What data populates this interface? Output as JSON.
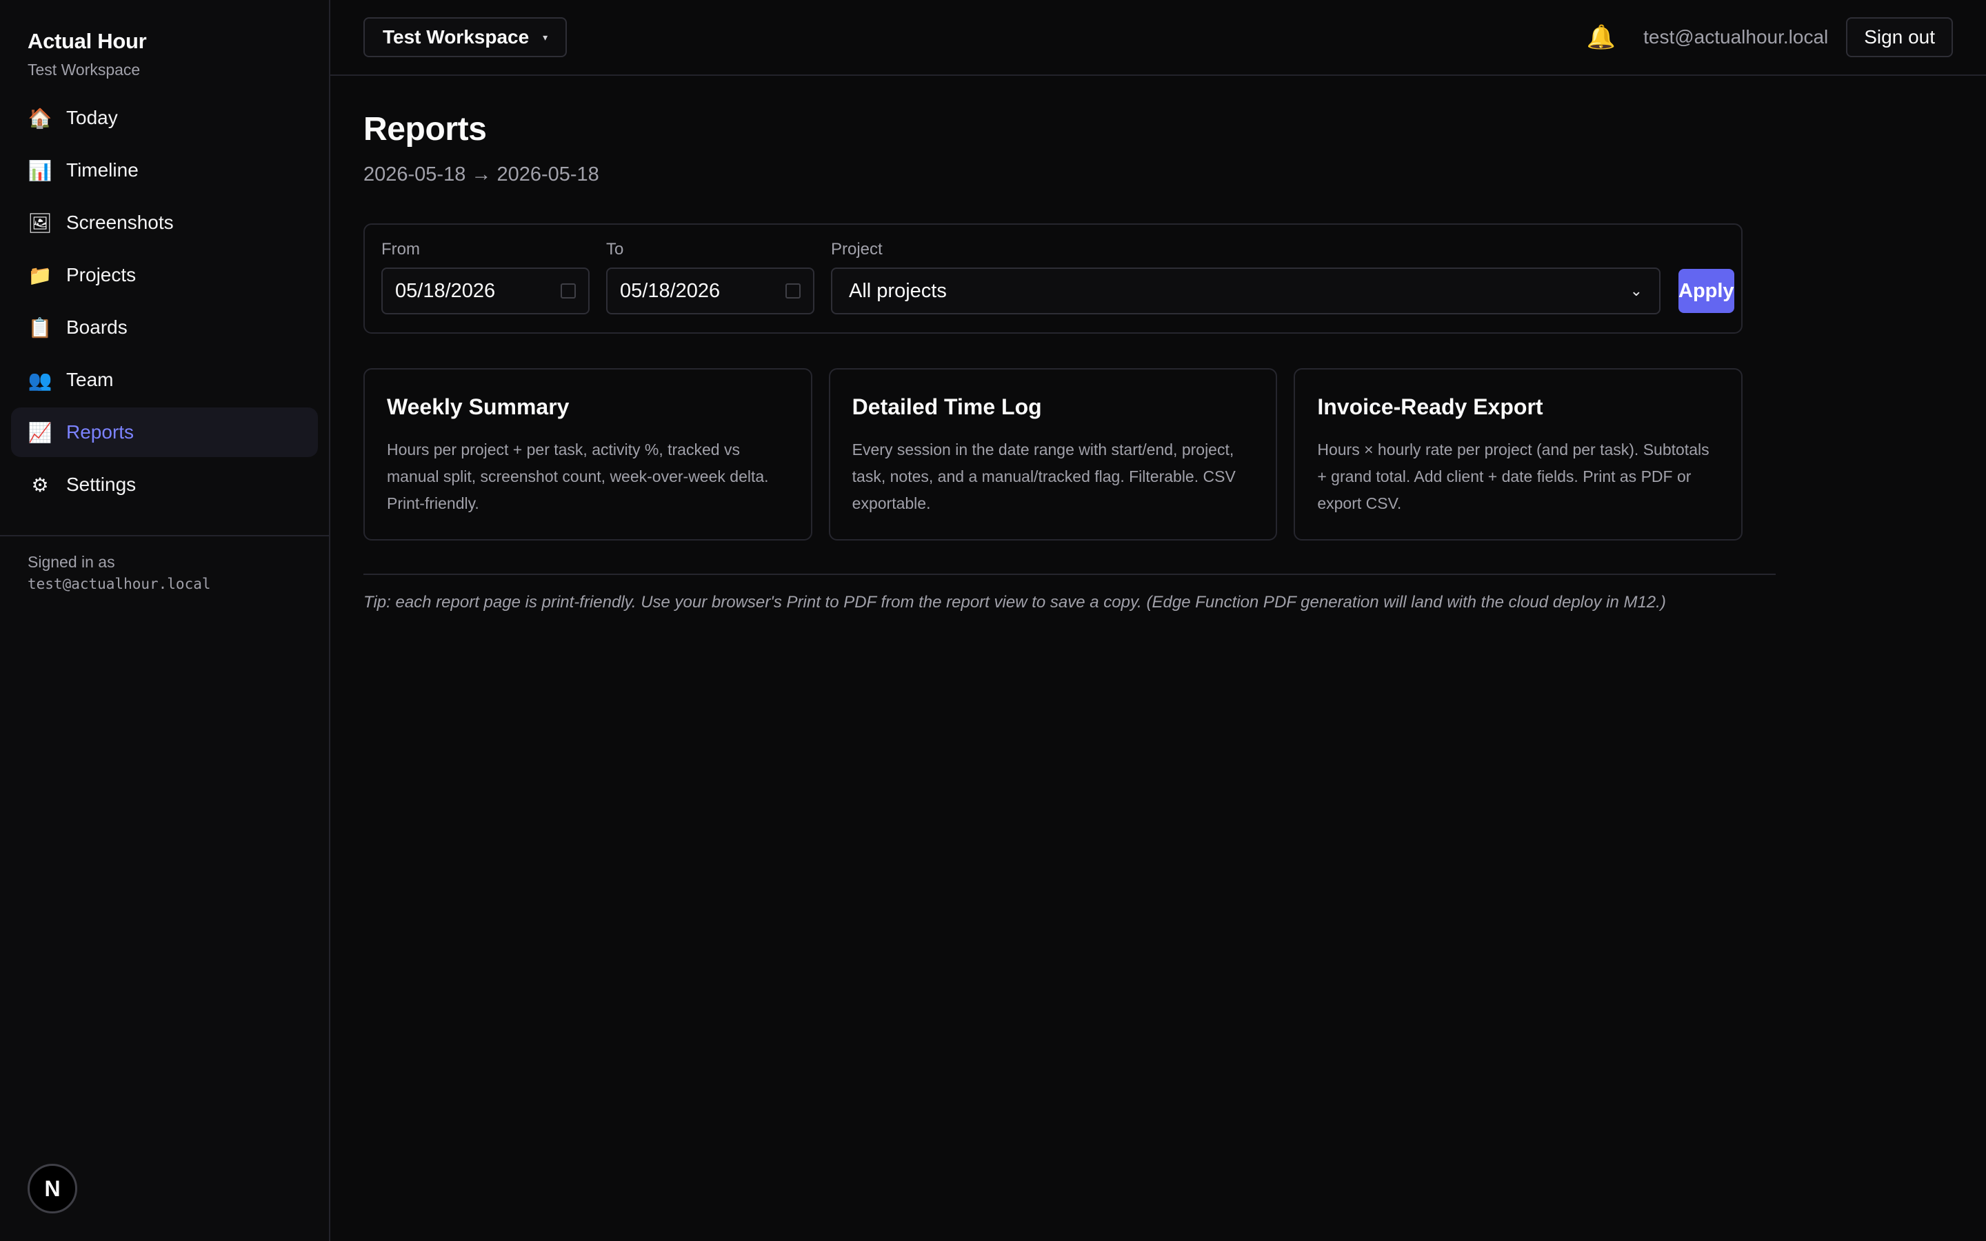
{
  "brand": {
    "title": "Actual Hour",
    "workspace": "Test Workspace"
  },
  "sidebar": {
    "items": [
      {
        "label": "Today",
        "icon": "🏠"
      },
      {
        "label": "Timeline",
        "icon": "📊"
      },
      {
        "label": "Screenshots",
        "icon": "🖼"
      },
      {
        "label": "Projects",
        "icon": "📁"
      },
      {
        "label": "Boards",
        "icon": "📋"
      },
      {
        "label": "Team",
        "icon": "👥"
      },
      {
        "label": "Reports",
        "icon": "📈",
        "active": true
      },
      {
        "label": "Settings",
        "icon": "⚙"
      }
    ],
    "signed_in_label": "Signed in as",
    "signed_in_email": "test@actualhour.local",
    "badge": "N"
  },
  "topbar": {
    "workspace": "Test Workspace",
    "caret": "▾",
    "bell_icon": "🔔",
    "user_email": "test@actualhour.local",
    "sign_out": "Sign out"
  },
  "page": {
    "title": "Reports",
    "range": "2026-05-18 → 2026-05-18"
  },
  "filters": {
    "from_label": "From",
    "from_value": "05/18/2026",
    "to_label": "To",
    "to_value": "05/18/2026",
    "project_label": "Project",
    "project_value": "All projects",
    "apply": "Apply"
  },
  "cards": [
    {
      "title": "Weekly Summary",
      "desc": "Hours per project + per task, activity %, tracked vs manual split, screenshot count, week-over-week delta. Print-friendly."
    },
    {
      "title": "Detailed Time Log",
      "desc": "Every session in the date range with start/end, project, task, notes, and a manual/tracked flag. Filterable. CSV exportable."
    },
    {
      "title": "Invoice-Ready Export",
      "desc": "Hours × hourly rate per project (and per task). Subtotals + grand total. Add client + date fields. Print as PDF or export CSV."
    }
  ],
  "tip": "Tip: each report page is print-friendly. Use your browser's Print to PDF from the report view to save a copy. (Edge Function PDF generation will land with the cloud deploy in M12.)",
  "colors": {
    "accent": "#6366f1",
    "active_nav_text": "#7c83ff",
    "background": "#0a0a0b"
  }
}
